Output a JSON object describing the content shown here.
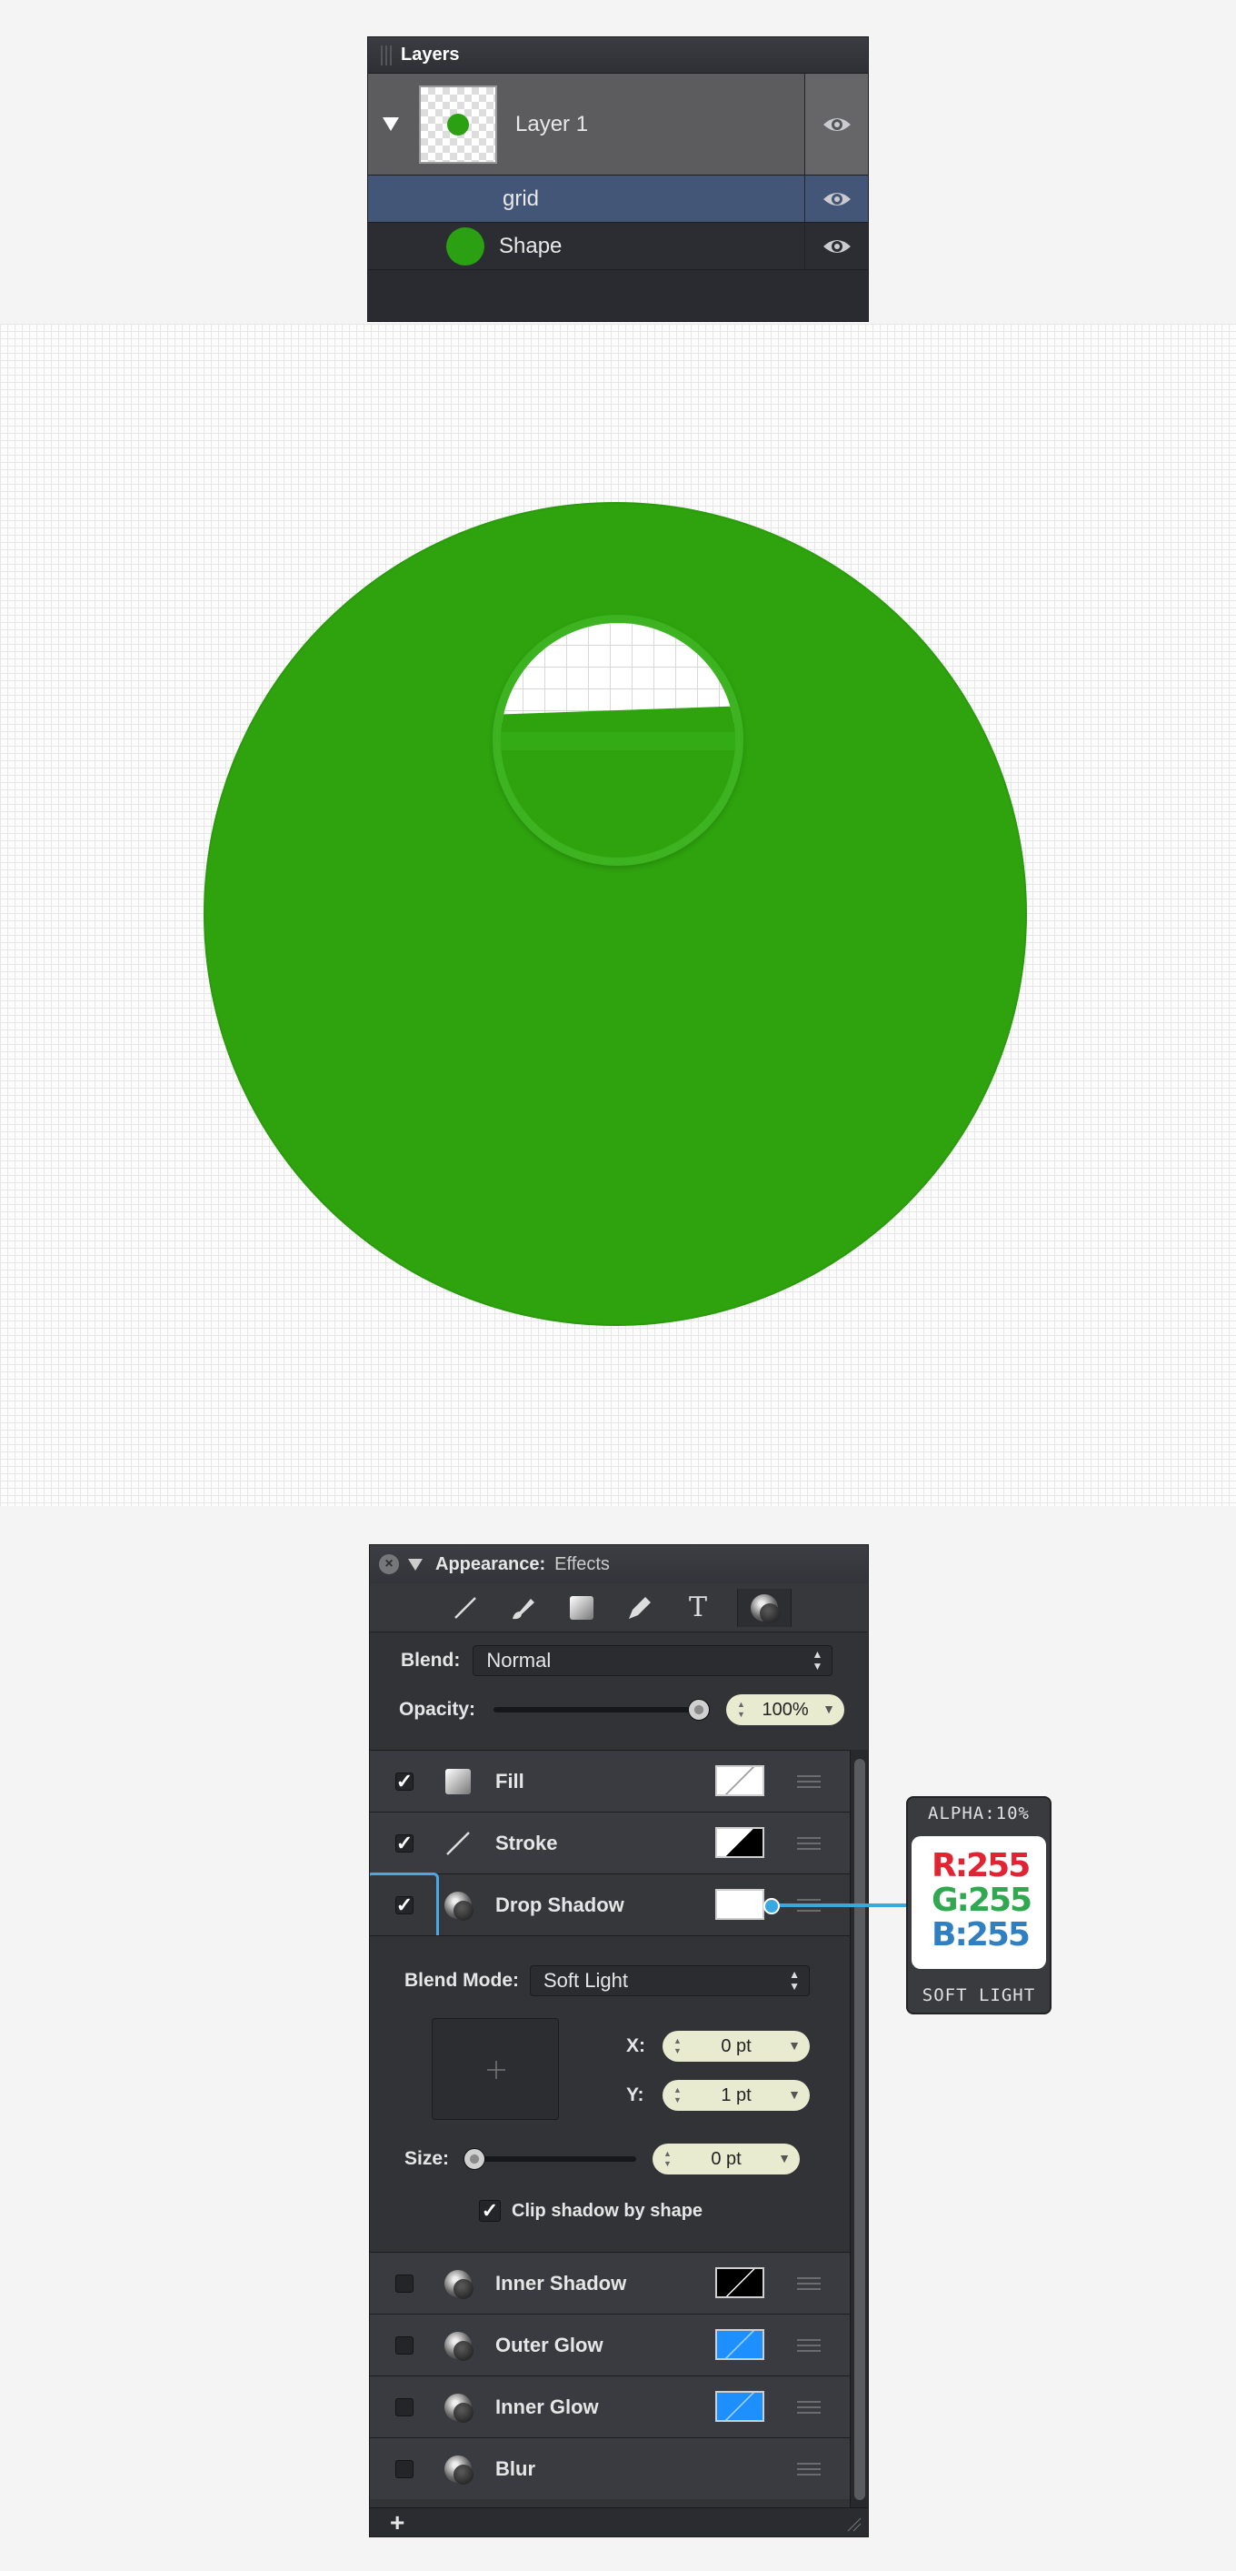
{
  "layers_panel": {
    "title": "Layers",
    "rows": [
      {
        "name": "Layer 1",
        "visible": true
      },
      {
        "name": "grid",
        "visible": true,
        "selected": true
      },
      {
        "name": "Shape",
        "visible": true,
        "color": "#2aa012"
      }
    ]
  },
  "canvas": {
    "shape_color": "#2ea30e"
  },
  "appearance": {
    "header_label": "Appearance:",
    "header_sub": "Effects",
    "tools": [
      "stroke-tool-icon",
      "brush-icon",
      "fill-square-icon",
      "pen-icon",
      "text-icon",
      "effects-icon"
    ],
    "text_tool_glyph": "T",
    "blend_label": "Blend:",
    "blend_value": "Normal",
    "opacity_label": "Opacity:",
    "opacity_value": "100%",
    "opacity_fraction": 1.0,
    "effects": {
      "fill": {
        "label": "Fill",
        "checked": true
      },
      "stroke": {
        "label": "Stroke",
        "checked": true
      },
      "drop_shadow": {
        "label": "Drop Shadow",
        "checked": true
      },
      "inner_shadow": {
        "label": "Inner Shadow",
        "checked": false
      },
      "outer_glow": {
        "label": "Outer Glow",
        "checked": false
      },
      "inner_glow": {
        "label": "Inner Glow",
        "checked": false
      },
      "blur": {
        "label": "Blur",
        "checked": false
      }
    },
    "drop_shadow_settings": {
      "blend_mode_label": "Blend Mode:",
      "blend_mode_value": "Soft Light",
      "x_label": "X:",
      "x_value": "0 pt",
      "y_label": "Y:",
      "y_value": "1 pt",
      "size_label": "Size:",
      "size_value": "0 pt",
      "size_fraction": 0.0,
      "clip_label": "Clip shadow by shape",
      "clip_checked": true
    },
    "add_button": "+",
    "check_glyph": "✓"
  },
  "color_tooltip": {
    "alpha": "ALPHA:10%",
    "r": "R:255",
    "g": "G:255",
    "b": "B:255",
    "mode": "SOFT LIGHT",
    "r_color": "#e02433",
    "g_color": "#2fa84f",
    "b_color": "#2f7fc1"
  }
}
